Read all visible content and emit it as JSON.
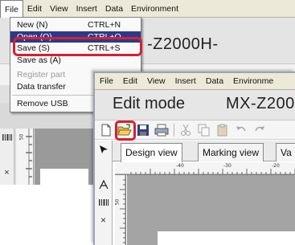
{
  "back_window": {
    "menubar": [
      "File",
      "Edit",
      "View",
      "Insert",
      "Data",
      "Environment"
    ],
    "title_partial": "-Z2000H-",
    "file_menu": {
      "items": [
        {
          "label": "New (N)",
          "shortcut": "CTRL+N",
          "state": "normal"
        },
        {
          "label": "Open (O)...",
          "shortcut": "CTRL+O",
          "state": "selected"
        },
        {
          "label": "Save (S)",
          "shortcut": "CTRL+S",
          "state": "normal"
        },
        {
          "label": "Save as (A)",
          "shortcut": "",
          "state": "normal"
        },
        {
          "label": "Register part",
          "shortcut": "",
          "state": "disabled"
        },
        {
          "label": "Data transfer",
          "shortcut": "",
          "state": "normal"
        },
        {
          "label": "Remove USB",
          "shortcut": "",
          "state": "normal"
        }
      ]
    },
    "ruler_label": "50"
  },
  "front_window": {
    "menubar": [
      "File",
      "Edit",
      "View",
      "Insert",
      "Data",
      "Environme"
    ],
    "mode_title": "Edit mode",
    "model_title": "MX-Z200(",
    "tabs": [
      "Design view",
      "Marking view",
      "Va"
    ],
    "ruler_h_labels": [
      "-40",
      "-30",
      "-20"
    ],
    "ruler_v_label": "50",
    "highlight_color": "#d62031"
  }
}
